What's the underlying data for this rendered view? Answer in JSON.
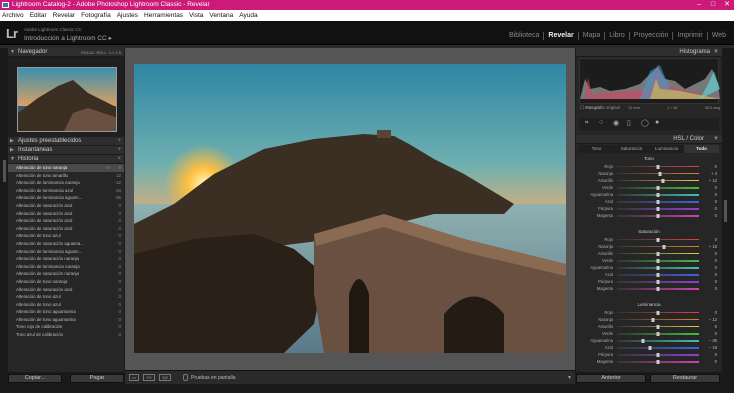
{
  "window": {
    "title": "Lightroom Catalog-2 - Adobe Photoshop Lightroom Classic - Revelar",
    "controls": [
      "–",
      "□",
      "✕"
    ]
  },
  "menu": [
    "Archivo",
    "Editar",
    "Revelar",
    "Fotografía",
    "Ajustes",
    "Herramientas",
    "Vista",
    "Ventana",
    "Ayuda"
  ],
  "identity": {
    "logo": "Lr",
    "subtitle": "Adobe Lightroom Classic CC",
    "catalog": "Introducción a Lightroom CC",
    "caret": "▸"
  },
  "modules": [
    "Biblioteca",
    "Revelar",
    "Mapa",
    "Libro",
    "Proyección",
    "Imprimir",
    "Web"
  ],
  "active_module": "Revelar",
  "navigator": {
    "title": "Navegador",
    "views": "ENCAJ.  RELL.  1:1  1:5"
  },
  "presets": {
    "title": "Ajustes preestablecidos"
  },
  "snapshots": {
    "title": "Instantáneas"
  },
  "history": {
    "title": "Historia",
    "items": [
      {
        "label": "Alteración de tono naranja",
        "v1": "+4",
        "v2": "8"
      },
      {
        "label": "Alteración de tono amarillo",
        "v1": "",
        "v2": "12"
      },
      {
        "label": "Alteración de luminancia naranja",
        "v1": "",
        "v2": "-12"
      },
      {
        "label": "Alteración de luminancia azul",
        "v1": "",
        "v2": "-19"
      },
      {
        "label": "Alteración de luminancia aguam...",
        "v1": "",
        "v2": "-36"
      },
      {
        "label": "Alteración de saturación azul",
        "v1": "",
        "v2": "0"
      },
      {
        "label": "Alteración de saturación azul",
        "v1": "",
        "v2": "0"
      },
      {
        "label": "Alteración de saturación azul",
        "v1": "",
        "v2": "0"
      },
      {
        "label": "Alteración de saturación azul",
        "v1": "",
        "v2": "0"
      },
      {
        "label": "Alteración de tono azul",
        "v1": "",
        "v2": "0"
      },
      {
        "label": "Alteración de saturación aguama...",
        "v1": "",
        "v2": "0"
      },
      {
        "label": "Alteración de luminancia aguam...",
        "v1": "",
        "v2": "0"
      },
      {
        "label": "Alteración de saturación naranja",
        "v1": "",
        "v2": "0"
      },
      {
        "label": "Alteración de luminancia naranja",
        "v1": "",
        "v2": "0"
      },
      {
        "label": "Alteración de saturación naranja",
        "v1": "",
        "v2": "0"
      },
      {
        "label": "Alteración de tono naranja",
        "v1": "",
        "v2": "0"
      },
      {
        "label": "Alteración de saturación azul",
        "v1": "",
        "v2": "0"
      },
      {
        "label": "Alteración de tono azul",
        "v1": "",
        "v2": "0"
      },
      {
        "label": "Alteración de tono azul",
        "v1": "",
        "v2": "0"
      },
      {
        "label": "Alteración de tono aguamarina",
        "v1": "",
        "v2": "0"
      },
      {
        "label": "Alteración de tono aguamarina",
        "v1": "",
        "v2": "0"
      },
      {
        "label": "Tono rojo de calibración",
        "v1": "",
        "v2": "0"
      },
      {
        "label": "Tono azul de calibración",
        "v1": "",
        "v2": "0"
      }
    ]
  },
  "left_buttons": {
    "copy": "Copiar...",
    "paste": "Pegar"
  },
  "toolbar": {
    "softproof": "Pruebas en pantalla"
  },
  "histogram": {
    "title": "Histograma",
    "iso": "ISO 100",
    "focal": "11 mm",
    "aperture": "ƒ / 16",
    "shutter": "30.0 seg",
    "original": "Fotografía original"
  },
  "hsl": {
    "title": "HSL / Color",
    "tabs": [
      "Tono",
      "Saturación",
      "Luminancia",
      "Todo"
    ],
    "active_tab": "Todo",
    "sections": [
      {
        "name": "Tono",
        "rows": [
          [
            "Rojo",
            0
          ],
          [
            "Naranja",
            4
          ],
          [
            "Amarillo",
            12
          ],
          [
            "Verde",
            0
          ],
          [
            "Aguamarina",
            0
          ],
          [
            "Azul",
            0
          ],
          [
            "Púrpura",
            0
          ],
          [
            "Magenta",
            0
          ]
        ],
        "vals": [
          "0",
          "+ 4",
          "+ 12",
          "0",
          "0",
          "0",
          "0",
          "0"
        ]
      },
      {
        "name": "Saturación",
        "rows": [
          [
            "Rojo",
            0
          ],
          [
            "Naranja",
            15
          ],
          [
            "Amarillo",
            0
          ],
          [
            "Verde",
            0
          ],
          [
            "Aguamarina",
            0
          ],
          [
            "Azul",
            0
          ],
          [
            "Púrpura",
            0
          ],
          [
            "Magenta",
            0
          ]
        ],
        "vals": [
          "0",
          "+ 15",
          "0",
          "0",
          "0",
          "0",
          "0",
          "0"
        ]
      },
      {
        "name": "Luminancia",
        "rows": [
          [
            "Rojo",
            0
          ],
          [
            "Naranja",
            -12
          ],
          [
            "Amarillo",
            0
          ],
          [
            "Verde",
            0
          ],
          [
            "Aguamarina",
            -36
          ],
          [
            "Azul",
            -19
          ],
          [
            "Púrpura",
            0
          ],
          [
            "Magenta",
            0
          ]
        ],
        "vals": [
          "0",
          "− 12",
          "0",
          "0",
          "− 36",
          "− 19",
          "0",
          "0"
        ]
      }
    ]
  },
  "right_buttons": {
    "previous": "Anterior",
    "reset": "Restaurar"
  }
}
